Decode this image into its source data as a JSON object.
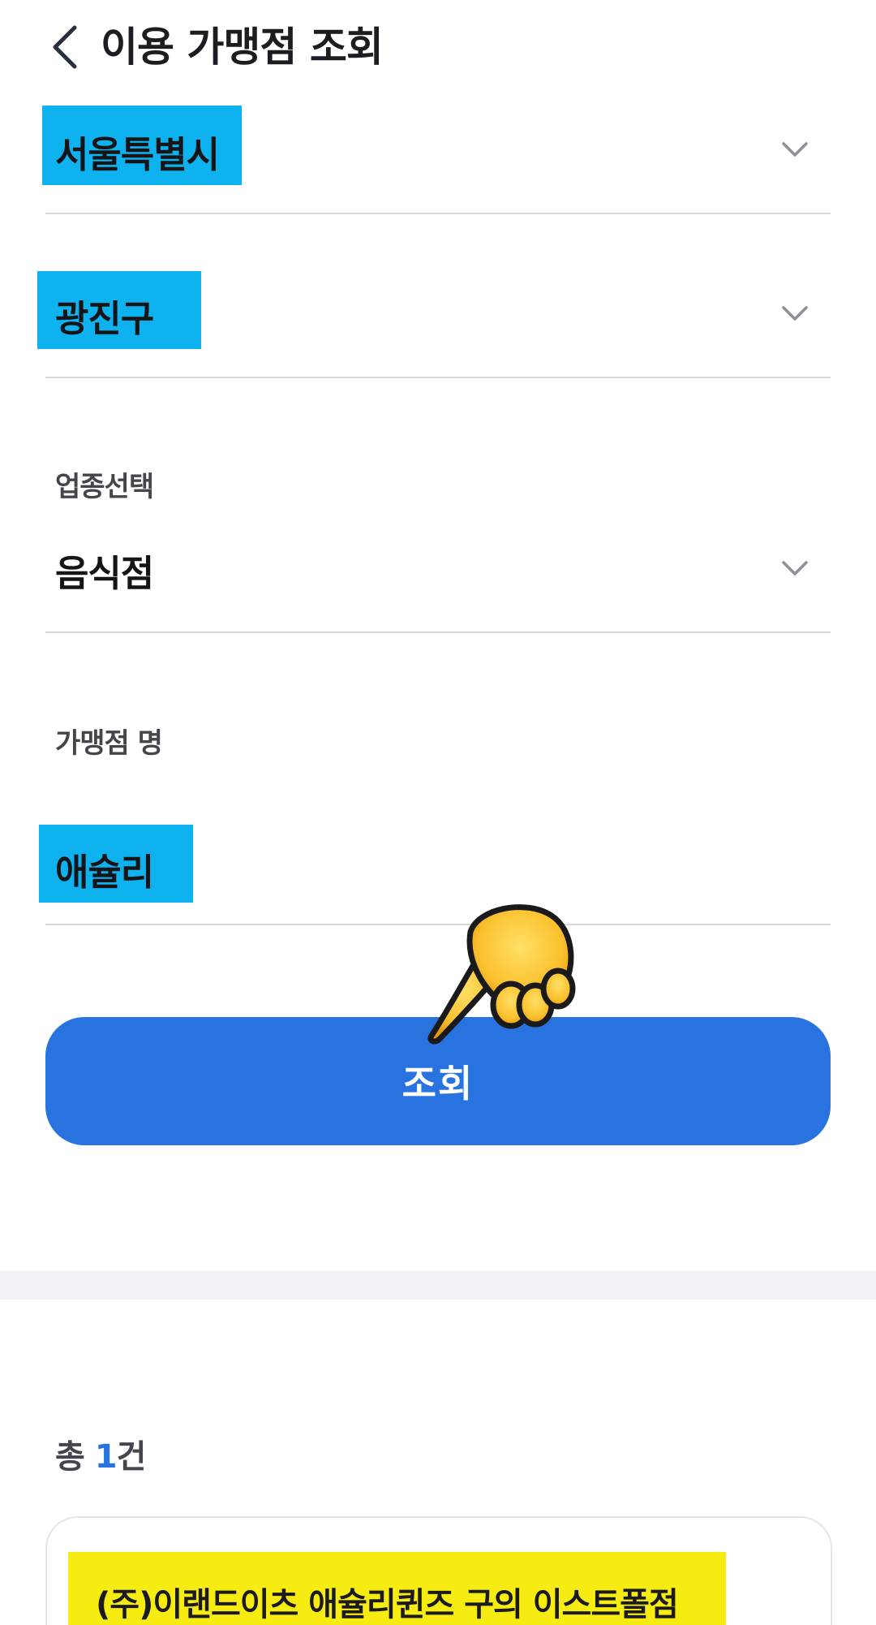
{
  "header": {
    "title": "이용 가맹점 조회",
    "back_icon": "chevron-left-icon"
  },
  "form": {
    "city": {
      "value": "서울특별시",
      "icon": "chevron-down-icon"
    },
    "district": {
      "value": "광진구",
      "icon": "chevron-down-icon"
    },
    "category": {
      "label": "업종선택",
      "value": "음식점",
      "icon": "chevron-down-icon"
    },
    "store_name": {
      "label": "가맹점 명",
      "value": "애슐리"
    }
  },
  "search_button": {
    "label": "조회"
  },
  "results": {
    "count_prefix": "총 ",
    "count": "1",
    "count_suffix": "건",
    "items": [
      {
        "name": "(주)이랜드이츠 애슐리퀸즈 구의 이스트폴점"
      }
    ]
  },
  "colors": {
    "accent": "#2873df",
    "highlight_cyan": "#0db2ef",
    "highlight_yellow": "#f7ec12",
    "divider": "#d6d7db"
  }
}
